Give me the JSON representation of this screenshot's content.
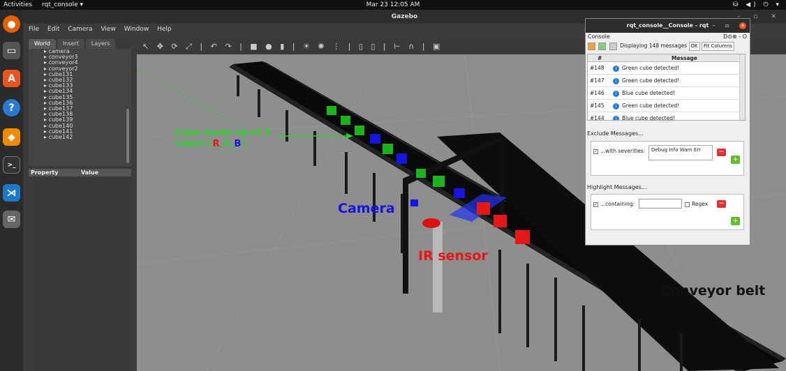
{
  "topbar": {
    "activities": "Activities",
    "app": "rqt_console ▾",
    "clock": "Mar 23  12:05 AM",
    "tray": "⛁ ◀) ⏻ ▾"
  },
  "gazebo": {
    "title": "Gazebo",
    "menu": [
      "File",
      "Edit",
      "Camera",
      "View",
      "Window",
      "Help"
    ],
    "tabs": [
      "World",
      "Insert",
      "Layers"
    ],
    "tree": [
      "camera",
      "conveyor3",
      "conveyor4",
      "conveyor2",
      "cube131",
      "cube132",
      "cube133",
      "cube134",
      "cube135",
      "cube136",
      "cube137",
      "cube138",
      "cube139",
      "cube140",
      "cube141",
      "cube142"
    ],
    "prop_header": {
      "property": "Property",
      "value": "Value"
    },
    "toolbar_icons": "↖ ✥ ⟳ ⤢ | ↶ ↷ | ■ ● ▮ | ☀ ✺ ⋮ | ▯ ▯ | ⊢ ∩ | ▣"
  },
  "annotations": {
    "cube_line1": "Cube made up of 3",
    "cube_line2_prefix": "colors (",
    "r": "R",
    "g": "G",
    "b": "B",
    "close": ")",
    "camera": "Camera",
    "ir": "IR sensor",
    "belt": "Conveyor belt"
  },
  "rqt": {
    "title": "rqt_console__Console - rqt",
    "dock_title": "Console",
    "dock_right": "D⊙⊗ - O",
    "displaying": "Displaying 148 messages",
    "ok": "OK",
    "fit": "Fit Columns",
    "headers": {
      "num": "#",
      "message": "Message"
    },
    "rows": [
      {
        "num": "#148",
        "msg": "Green cube detected!"
      },
      {
        "num": "#147",
        "msg": "Green cube detected!"
      },
      {
        "num": "#146",
        "msg": "Blue cube detected!"
      },
      {
        "num": "#145",
        "msg": "Green cube detected!"
      },
      {
        "num": "#144",
        "msg": "Blue cube detected!"
      }
    ],
    "exclude": "Exclude Messages...",
    "with_sev": "...with severities:",
    "severities": "Debug  Info  Warn  Err",
    "highlight": "Highlight Messages...",
    "containing": "...containing:",
    "regex": "Regex"
  }
}
